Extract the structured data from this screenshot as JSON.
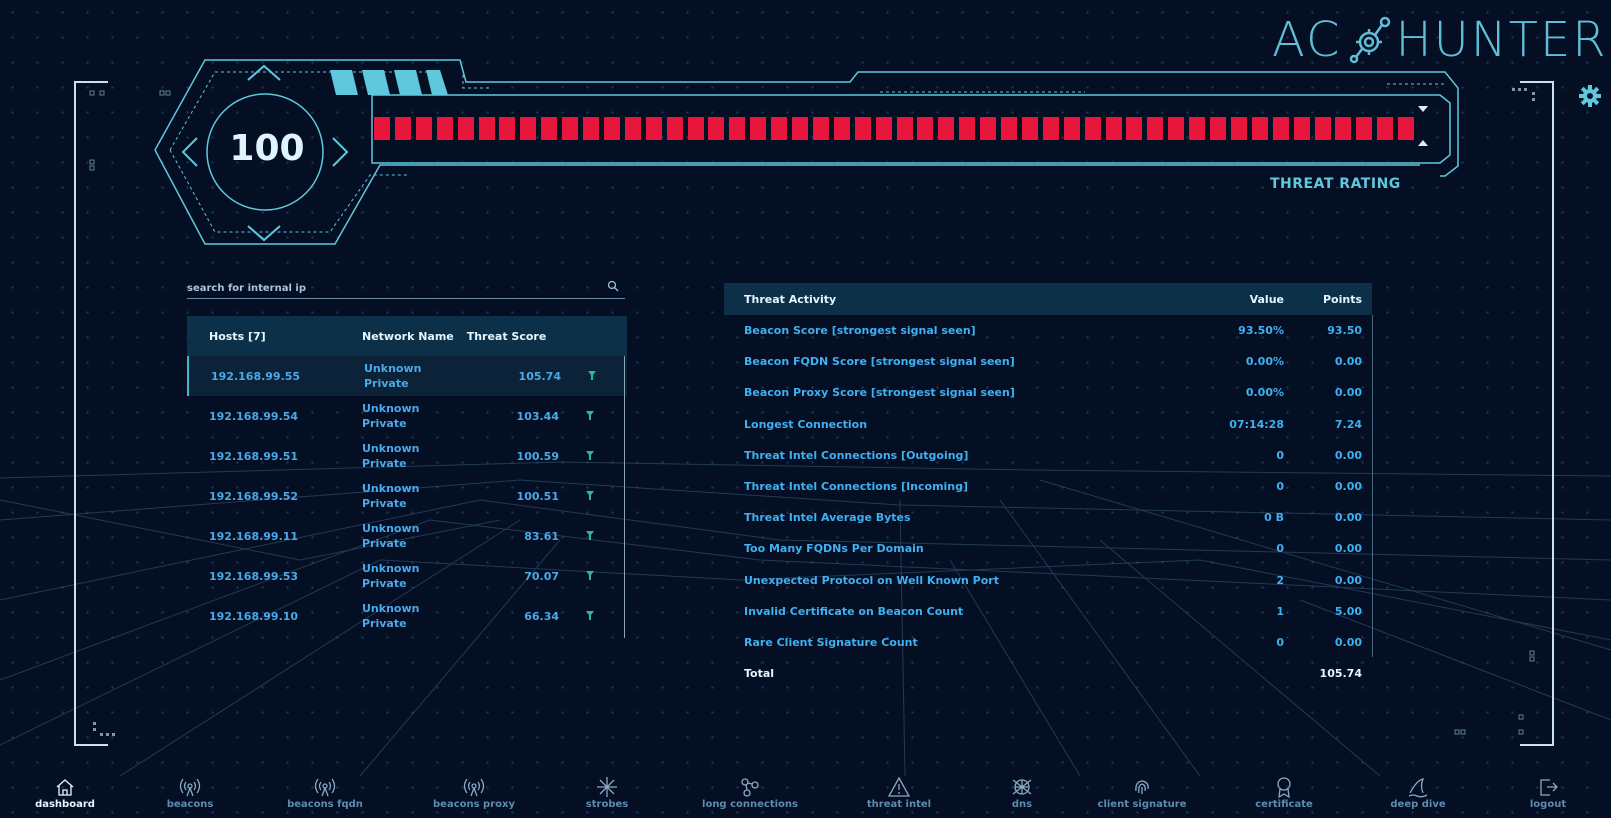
{
  "app": {
    "logo_text_left": "AC",
    "logo_text_right": "HUNTER"
  },
  "threat_rating": {
    "value": "100",
    "label": "THREAT RATING",
    "bar_fill": 1.0
  },
  "search": {
    "placeholder": "search for internal ip"
  },
  "hosts_table": {
    "headers": {
      "host": "Hosts [7]",
      "network": "Network Name",
      "score": "Threat Score"
    },
    "rows": [
      {
        "ip": "192.168.99.55",
        "network": "Unknown Private",
        "score": "105.74",
        "selected": true
      },
      {
        "ip": "192.168.99.54",
        "network": "Unknown Private",
        "score": "103.44"
      },
      {
        "ip": "192.168.99.51",
        "network": "Unknown Private",
        "score": "100.59"
      },
      {
        "ip": "192.168.99.52",
        "network": "Unknown Private",
        "score": "100.51"
      },
      {
        "ip": "192.168.99.11",
        "network": "Unknown Private",
        "score": "83.61"
      },
      {
        "ip": "192.168.99.53",
        "network": "Unknown Private",
        "score": "70.07"
      },
      {
        "ip": "192.168.99.10",
        "network": "Unknown Private",
        "score": "66.34"
      }
    ]
  },
  "activity_table": {
    "headers": {
      "activity": "Threat Activity",
      "value": "Value",
      "points": "Points"
    },
    "rows": [
      {
        "name": "Beacon Score [strongest signal seen]",
        "value": "93.50%",
        "points": "93.50"
      },
      {
        "name": "Beacon FQDN Score [strongest signal seen]",
        "value": "0.00%",
        "points": "0.00"
      },
      {
        "name": "Beacon Proxy Score [strongest signal seen]",
        "value": "0.00%",
        "points": "0.00"
      },
      {
        "name": "Longest Connection",
        "value": "07:14:28",
        "points": "7.24"
      },
      {
        "name": "Threat Intel Connections [Outgoing]",
        "value": "0",
        "points": "0.00"
      },
      {
        "name": "Threat Intel Connections [Incoming]",
        "value": "0",
        "points": "0.00"
      },
      {
        "name": "Threat Intel Average Bytes",
        "value": "0 B",
        "points": "0.00"
      },
      {
        "name": "Too Many FQDNs Per Domain",
        "value": "0",
        "points": "0.00"
      },
      {
        "name": "Unexpected Protocol on Well Known Port",
        "value": "2",
        "points": "0.00"
      },
      {
        "name": "Invalid Certificate on Beacon Count",
        "value": "1",
        "points": "5.00"
      },
      {
        "name": "Rare Client Signature Count",
        "value": "0",
        "points": "0.00"
      }
    ],
    "total": {
      "name": "Total",
      "value": "",
      "points": "105.74"
    }
  },
  "nav": [
    {
      "label": "dashboard",
      "icon": "home-icon",
      "active": true
    },
    {
      "label": "beacons",
      "icon": "broadcast-icon"
    },
    {
      "label": "beacons fqdn",
      "icon": "broadcast-icon"
    },
    {
      "label": "beacons proxy",
      "icon": "broadcast-icon"
    },
    {
      "label": "strobes",
      "icon": "starburst-icon"
    },
    {
      "label": "long connections",
      "icon": "nodes-icon"
    },
    {
      "label": "threat intel",
      "icon": "warning-icon"
    },
    {
      "label": "dns",
      "icon": "globe-icon"
    },
    {
      "label": "client signature",
      "icon": "fingerprint-icon"
    },
    {
      "label": "certificate",
      "icon": "ribbon-icon"
    },
    {
      "label": "deep dive",
      "icon": "shark-fin-icon"
    },
    {
      "label": "logout",
      "icon": "logout-icon"
    }
  ],
  "colors": {
    "accent": "#5fc8dd",
    "link": "#3fb0f0",
    "danger": "#e8163c",
    "background": "#040f24",
    "header_bg": "#0b3047"
  }
}
